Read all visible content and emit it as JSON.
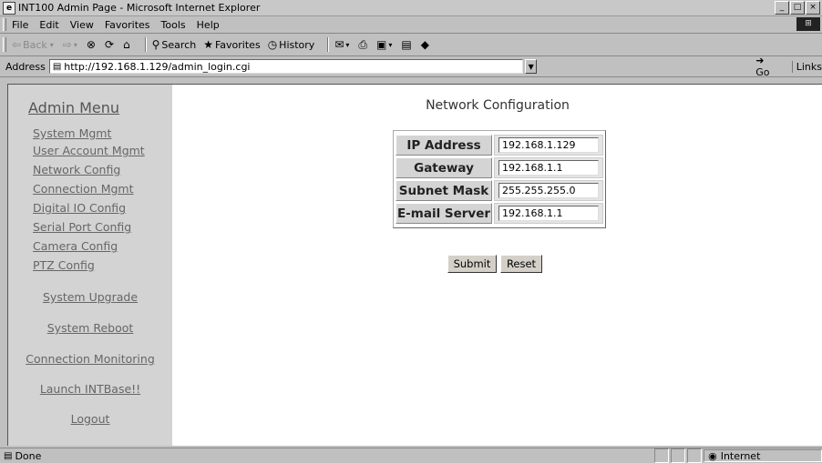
{
  "window": {
    "title": "INT100 Admin Page - Microsoft Internet Explorer"
  },
  "menu": [
    "File",
    "Edit",
    "View",
    "Favorites",
    "Tools",
    "Help"
  ],
  "toolbar": {
    "back": "Back",
    "search": "Search",
    "favorites": "Favorites",
    "history": "History"
  },
  "address": {
    "label": "Address",
    "url": "http://192.168.1.129/admin_login.cgi",
    "go": "Go",
    "links": "Links"
  },
  "sidebar": {
    "title": "Admin Menu",
    "items": [
      "System Mgmt",
      "User Account Mgmt",
      "Network Config",
      "Connection Mgmt",
      "Digital IO Config",
      "Serial Port Config",
      "Camera Config",
      "PTZ Config"
    ],
    "actions": [
      "System Upgrade",
      "System Reboot",
      "Connection Monitoring",
      "Launch INTBase!!",
      "Logout"
    ]
  },
  "main": {
    "title": "Network Configuration",
    "fields": [
      {
        "label": "IP Address",
        "value": "192.168.1.129"
      },
      {
        "label": "Gateway",
        "value": "192.168.1.1"
      },
      {
        "label": "Subnet Mask",
        "value": "255.255.255.0"
      },
      {
        "label": "E-mail Server",
        "value": "192.168.1.1"
      }
    ],
    "submit": "Submit",
    "reset": "Reset"
  },
  "status": {
    "left": "Done",
    "zone": "Internet"
  }
}
